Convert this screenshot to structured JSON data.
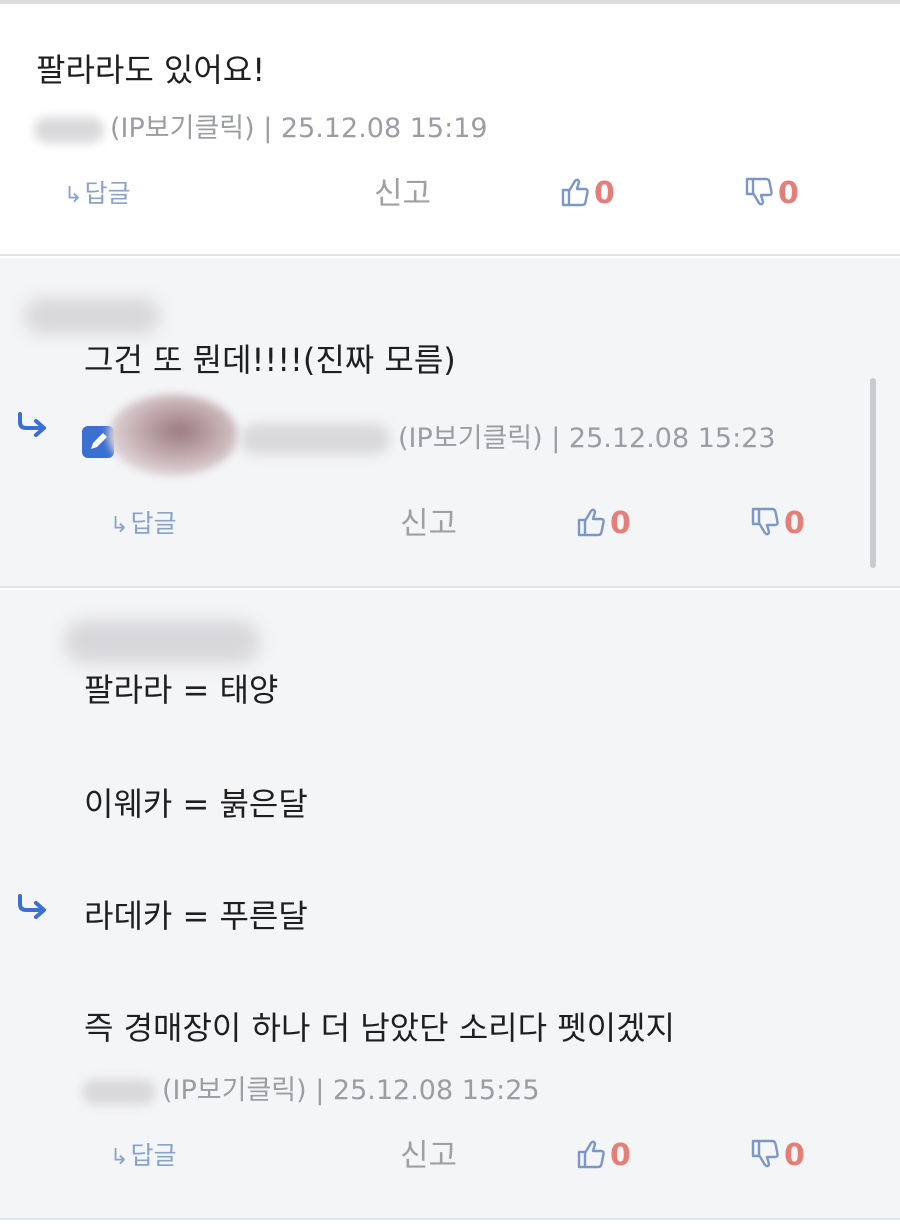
{
  "comments": [
    {
      "text_lines": [
        "팔라라도 있어요!"
      ],
      "meta_visible": "(IP보기클릭) | 25.12.08 15:19",
      "reply_label": "답글",
      "report_label": "신고",
      "like_count": "0",
      "dislike_count": "0"
    },
    {
      "text_lines": [
        "그건 또 뭔데!!!!(진짜 모름)"
      ],
      "meta_visible": "(IP보기클릭) | 25.12.08 15:23",
      "reply_label": "답글",
      "report_label": "신고",
      "like_count": "0",
      "dislike_count": "0"
    },
    {
      "text_lines": [
        "팔라라 = 태양",
        "이웨카 = 붉은달",
        "라데카 = 푸른달",
        "즉 경매장이 하나 더 남았단 소리다 펫이겠지"
      ],
      "meta_visible": "(IP보기클릭) | 25.12.08 15:25",
      "reply_label": "답글",
      "report_label": "신고",
      "like_count": "0",
      "dislike_count": "0"
    }
  ],
  "icons": {
    "reply_arrow": "reply-arrow-icon",
    "like": "thumbs-up-icon",
    "dislike": "thumbs-down-icon",
    "reply_indicator": "reply-indicator-icon",
    "edit": "pencil-icon"
  },
  "colors": {
    "accent_blue": "#3b6fd1",
    "vote_count": "#e37f78",
    "reply_link": "#8aa3c6",
    "meta_gray": "#9a9da3"
  }
}
